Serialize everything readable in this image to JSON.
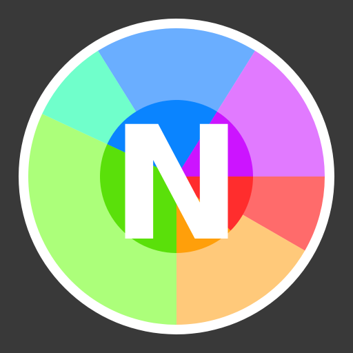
{
  "icon": {
    "name": "color-wheel-app-icon",
    "letter": "N",
    "colors": {
      "background": "#393939",
      "ring": "#ffffff",
      "letter": "#ffffff",
      "outer": {
        "blue": "#6aaeff",
        "purple": "#e17aff",
        "red": "#ff6b6b",
        "orange": "#ffc97a",
        "green": "#acff7a",
        "teal": "#70ffcb"
      },
      "inner": {
        "blue": "#0a84ff",
        "purple": "#cc14ff",
        "red": "#ff2d2d",
        "orange": "#ff9f0a",
        "green": "#5ae00a"
      }
    }
  }
}
